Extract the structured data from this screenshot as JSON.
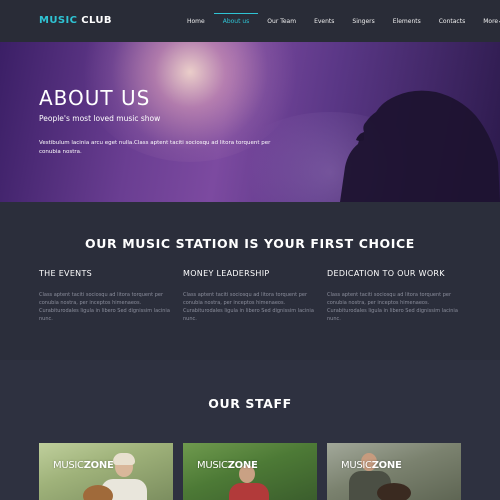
{
  "brand": {
    "name_part1": "MUSIC",
    "name_part2": "CLUB"
  },
  "nav": {
    "items": [
      {
        "label": "Home",
        "active": false
      },
      {
        "label": "About us",
        "active": true
      },
      {
        "label": "Our Team",
        "active": false
      },
      {
        "label": "Events",
        "active": false
      },
      {
        "label": "Singers",
        "active": false
      },
      {
        "label": "Elements",
        "active": false
      },
      {
        "label": "Contacts",
        "active": false
      },
      {
        "label": "More",
        "active": false
      }
    ],
    "more_caret": "▾"
  },
  "hero": {
    "title": "ABOUT US",
    "subtitle": "People's most loved music show",
    "text": "Vestibulum lacinia arcu eget nulla.Class aptent taciti sociosqu ad litora torquent per conubia nostra."
  },
  "features": {
    "title": "OUR MUSIC STATION IS YOUR FIRST CHOICE",
    "columns": [
      {
        "heading": "THE EVENTS",
        "text": "Class aptent taciti sociosqu ad litora torquent per conubia nostra, per inceptos himenaeos. Curabiturodales ligula in libero Sed dignissim lacinia nunc."
      },
      {
        "heading": "MONEY LEADERSHIP",
        "text": "Class aptent taciti sociosqu ad litora torquent per conubia nostra, per inceptos himenaeos. Curabiturodales ligula in libero Sed dignissim lacinia nunc."
      },
      {
        "heading": "DEDICATION TO OUR WORK",
        "text": "Class aptent taciti sociosqu ad litora torquent per conubia nostra, per inceptos himenaeos. Curabiturodales ligula in libero Sed dignissim lacinia nunc."
      }
    ]
  },
  "staff": {
    "title": "OUR STAFF",
    "cards": [
      {
        "label_part1": "MUSIC",
        "label_part2": "ZONE"
      },
      {
        "label_part1": "MUSIC",
        "label_part2": "ZONE"
      },
      {
        "label_part1": "MUSIC",
        "label_part2": "ZONE"
      }
    ]
  },
  "colors": {
    "accent": "#2fc4d4",
    "background": "#2b2e3b",
    "navbar": "#292c37",
    "muted_text": "#8b8e9c"
  }
}
